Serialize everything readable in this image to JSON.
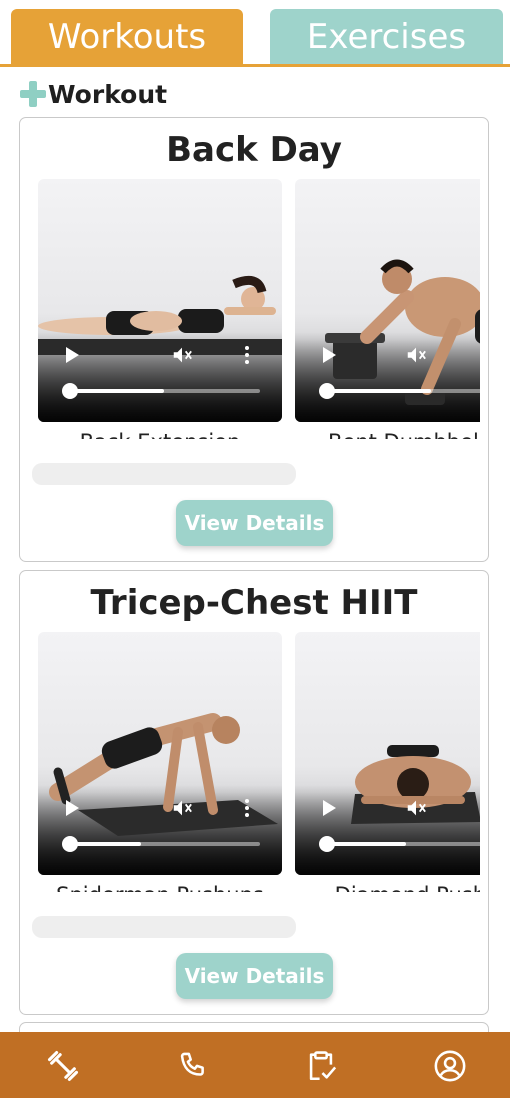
{
  "tabs": {
    "workouts": "Workouts",
    "exercises": "Exercises",
    "active": "Workouts"
  },
  "add_workout": {
    "label": "Workout"
  },
  "workouts": [
    {
      "title": "Back Day",
      "exercises": [
        {
          "name": "Back Extension"
        },
        {
          "name": "Bent Dumbbell R"
        }
      ],
      "button": "View Details"
    },
    {
      "title": "Tricep-Chest HIIT",
      "exercises": [
        {
          "name": "Spiderman Pushups"
        },
        {
          "name": "Diamond Pushu"
        }
      ],
      "button": "View Details"
    }
  ],
  "bottom_nav": [
    {
      "icon": "dumbbell-icon"
    },
    {
      "icon": "phone-icon"
    },
    {
      "icon": "clipboard-check-icon"
    },
    {
      "icon": "profile-icon"
    }
  ],
  "colors": {
    "orange": "#E6A237",
    "teal": "#9ED3CB",
    "nav": "#C06F24"
  }
}
